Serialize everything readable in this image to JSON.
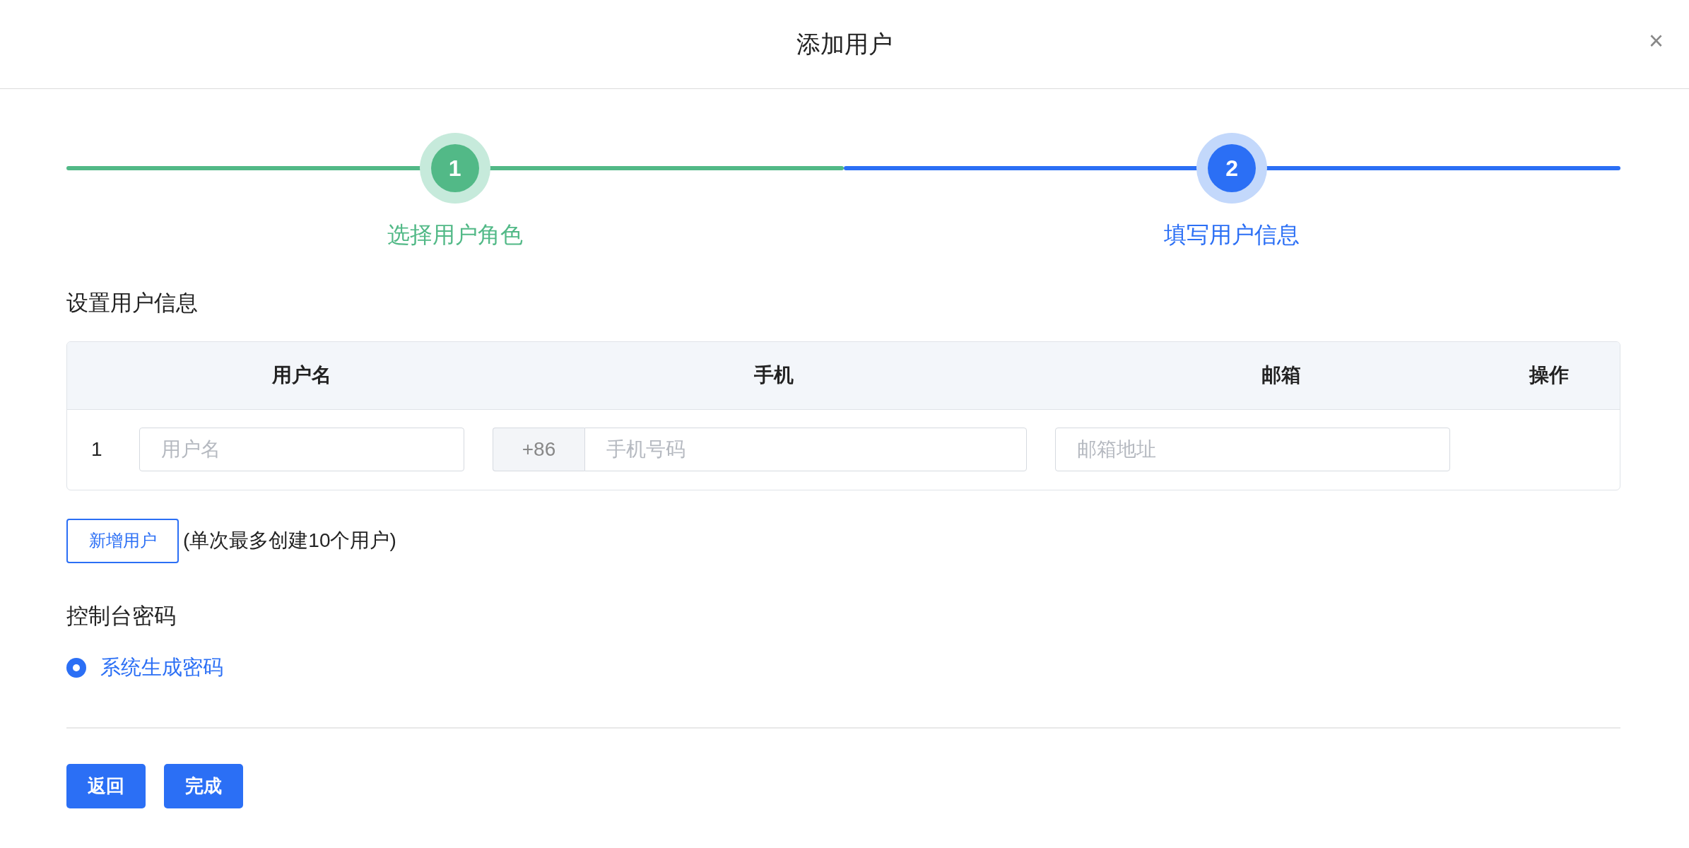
{
  "dialog": {
    "title": "添加用户",
    "close": "×"
  },
  "steps": [
    {
      "number": "1",
      "label": "选择用户角色",
      "kind": "finished"
    },
    {
      "number": "2",
      "label": "填写用户信息",
      "kind": "active"
    }
  ],
  "user_section": {
    "title": "设置用户信息"
  },
  "table": {
    "columns": [
      "用户名",
      "手机",
      "邮箱",
      "操作"
    ],
    "rows": [
      {
        "index": "1",
        "username": {
          "placeholder": "用户名"
        },
        "phone_prefix": "+86",
        "phone": {
          "placeholder": "手机号码"
        },
        "email": {
          "placeholder": "邮箱地址"
        }
      }
    ]
  },
  "add_user": {
    "button": "新增用户",
    "note": "(单次最多创建10个用户)"
  },
  "password_section": {
    "title": "控制台密码",
    "options": [
      {
        "label": "系统生成密码",
        "selected": true
      }
    ]
  },
  "buttons": [
    "返回",
    "完成"
  ]
}
